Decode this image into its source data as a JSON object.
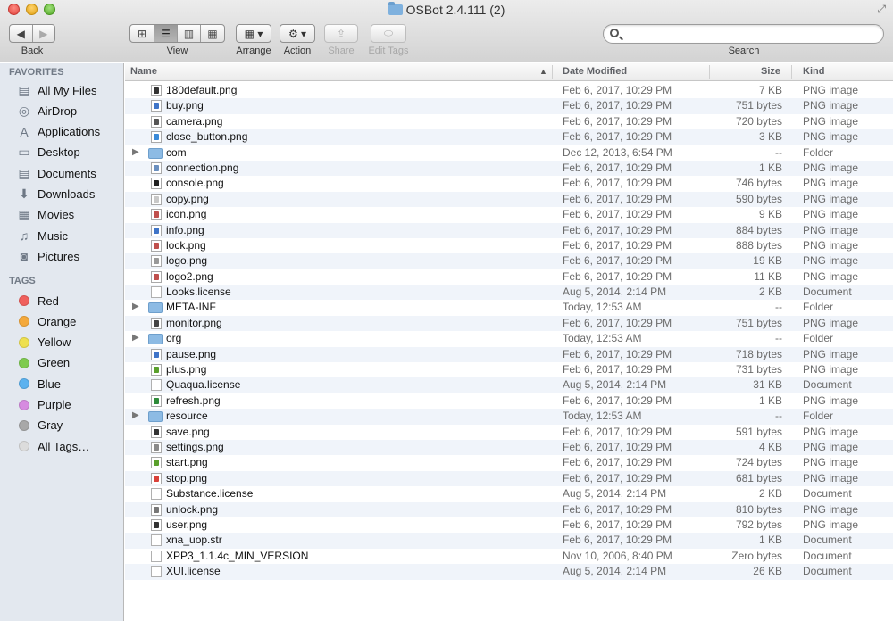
{
  "window": {
    "title": "OSBot 2.4.111 (2)",
    "fullscreen_glyph": "⤢"
  },
  "toolbar": {
    "back_label": "Back",
    "view_label": "View",
    "arrange_label": "Arrange",
    "action_label": "Action",
    "share_label": "Share",
    "edit_tags_label": "Edit Tags",
    "search_label": "Search",
    "search_placeholder": "",
    "back_glyph": "◀",
    "forward_glyph": "▶",
    "view_icons_glyph": "⊞",
    "view_list_glyph": "☰",
    "view_columns_glyph": "▥",
    "view_coverflow_glyph": "▦",
    "arrange_glyph": "▦ ▾",
    "action_glyph": "⚙ ▾",
    "share_glyph": "⇪",
    "edit_tags_glyph": "⬭"
  },
  "sidebar": {
    "favorites_heading": "FAVORITES",
    "favorites": [
      {
        "label": "All My Files",
        "icon": "all-files-icon",
        "glyph": "▤"
      },
      {
        "label": "AirDrop",
        "icon": "airdrop-icon",
        "glyph": "◎"
      },
      {
        "label": "Applications",
        "icon": "applications-icon",
        "glyph": "A"
      },
      {
        "label": "Desktop",
        "icon": "desktop-icon",
        "glyph": "▭"
      },
      {
        "label": "Documents",
        "icon": "documents-icon",
        "glyph": "▤"
      },
      {
        "label": "Downloads",
        "icon": "downloads-icon",
        "glyph": "⬇"
      },
      {
        "label": "Movies",
        "icon": "movies-icon",
        "glyph": "▦"
      },
      {
        "label": "Music",
        "icon": "music-icon",
        "glyph": "♫"
      },
      {
        "label": "Pictures",
        "icon": "pictures-icon",
        "glyph": "◙"
      }
    ],
    "tags_heading": "TAGS",
    "tags": [
      {
        "label": "Red",
        "color": "#f0605d"
      },
      {
        "label": "Orange",
        "color": "#f4a93c"
      },
      {
        "label": "Yellow",
        "color": "#eee04f"
      },
      {
        "label": "Green",
        "color": "#7ecb4f"
      },
      {
        "label": "Blue",
        "color": "#5cb2ef"
      },
      {
        "label": "Purple",
        "color": "#d68be0"
      },
      {
        "label": "Gray",
        "color": "#a8a8a8"
      },
      {
        "label": "All Tags…",
        "color": "#dcdcdc"
      }
    ]
  },
  "columns": {
    "name": "Name",
    "date": "Date Modified",
    "size": "Size",
    "kind": "Kind",
    "sort_glyph": "▲"
  },
  "files": [
    {
      "name": "180default.png",
      "date": "Feb 6, 2017, 10:29 PM",
      "size": "7 KB",
      "kind": "PNG image",
      "type": "png",
      "color": "#333333"
    },
    {
      "name": "buy.png",
      "date": "Feb 6, 2017, 10:29 PM",
      "size": "751 bytes",
      "kind": "PNG image",
      "type": "png",
      "color": "#3f74c8"
    },
    {
      "name": "camera.png",
      "date": "Feb 6, 2017, 10:29 PM",
      "size": "720 bytes",
      "kind": "PNG image",
      "type": "png",
      "color": "#555555"
    },
    {
      "name": "close_button.png",
      "date": "Feb 6, 2017, 10:29 PM",
      "size": "3 KB",
      "kind": "PNG image",
      "type": "png",
      "color": "#3a8ad8"
    },
    {
      "name": "com",
      "date": "Dec 12, 2013, 6:54 PM",
      "size": "--",
      "kind": "Folder",
      "type": "folder",
      "color": "#8dbbe4"
    },
    {
      "name": "connection.png",
      "date": "Feb 6, 2017, 10:29 PM",
      "size": "1 KB",
      "kind": "PNG image",
      "type": "png",
      "color": "#6a8fbf"
    },
    {
      "name": "console.png",
      "date": "Feb 6, 2017, 10:29 PM",
      "size": "746 bytes",
      "kind": "PNG image",
      "type": "png",
      "color": "#222222"
    },
    {
      "name": "copy.png",
      "date": "Feb 6, 2017, 10:29 PM",
      "size": "590 bytes",
      "kind": "PNG image",
      "type": "png",
      "color": "#c8c8c8"
    },
    {
      "name": "icon.png",
      "date": "Feb 6, 2017, 10:29 PM",
      "size": "9 KB",
      "kind": "PNG image",
      "type": "png",
      "color": "#c0504d"
    },
    {
      "name": "info.png",
      "date": "Feb 6, 2017, 10:29 PM",
      "size": "884 bytes",
      "kind": "PNG image",
      "type": "png",
      "color": "#3f74c8"
    },
    {
      "name": "lock.png",
      "date": "Feb 6, 2017, 10:29 PM",
      "size": "888 bytes",
      "kind": "PNG image",
      "type": "png",
      "color": "#c0504d"
    },
    {
      "name": "logo.png",
      "date": "Feb 6, 2017, 10:29 PM",
      "size": "19 KB",
      "kind": "PNG image",
      "type": "png",
      "color": "#999999"
    },
    {
      "name": "logo2.png",
      "date": "Feb 6, 2017, 10:29 PM",
      "size": "11 KB",
      "kind": "PNG image",
      "type": "png",
      "color": "#c0504d"
    },
    {
      "name": "Looks.license",
      "date": "Aug 5, 2014, 2:14 PM",
      "size": "2 KB",
      "kind": "Document",
      "type": "doc",
      "color": "#ffffff"
    },
    {
      "name": "META-INF",
      "date": "Today, 12:53 AM",
      "size": "--",
      "kind": "Folder",
      "type": "folder",
      "color": "#8dbbe4"
    },
    {
      "name": "monitor.png",
      "date": "Feb 6, 2017, 10:29 PM",
      "size": "751 bytes",
      "kind": "PNG image",
      "type": "png",
      "color": "#444444"
    },
    {
      "name": "org",
      "date": "Today, 12:53 AM",
      "size": "--",
      "kind": "Folder",
      "type": "folder",
      "color": "#8dbbe4"
    },
    {
      "name": "pause.png",
      "date": "Feb 6, 2017, 10:29 PM",
      "size": "718 bytes",
      "kind": "PNG image",
      "type": "png",
      "color": "#3f74c8"
    },
    {
      "name": "plus.png",
      "date": "Feb 6, 2017, 10:29 PM",
      "size": "731 bytes",
      "kind": "PNG image",
      "type": "png",
      "color": "#5aa02c"
    },
    {
      "name": "Quaqua.license",
      "date": "Aug 5, 2014, 2:14 PM",
      "size": "31 KB",
      "kind": "Document",
      "type": "doc",
      "color": "#ffffff"
    },
    {
      "name": "refresh.png",
      "date": "Feb 6, 2017, 10:29 PM",
      "size": "1 KB",
      "kind": "PNG image",
      "type": "png",
      "color": "#2e8b3a"
    },
    {
      "name": "resource",
      "date": "Today, 12:53 AM",
      "size": "--",
      "kind": "Folder",
      "type": "folder",
      "color": "#8dbbe4"
    },
    {
      "name": "save.png",
      "date": "Feb 6, 2017, 10:29 PM",
      "size": "591 bytes",
      "kind": "PNG image",
      "type": "png",
      "color": "#333333"
    },
    {
      "name": "settings.png",
      "date": "Feb 6, 2017, 10:29 PM",
      "size": "4 KB",
      "kind": "PNG image",
      "type": "png",
      "color": "#8a8a8a"
    },
    {
      "name": "start.png",
      "date": "Feb 6, 2017, 10:29 PM",
      "size": "724 bytes",
      "kind": "PNG image",
      "type": "png",
      "color": "#5aa02c"
    },
    {
      "name": "stop.png",
      "date": "Feb 6, 2017, 10:29 PM",
      "size": "681 bytes",
      "kind": "PNG image",
      "type": "png",
      "color": "#d9413a"
    },
    {
      "name": "Substance.license",
      "date": "Aug 5, 2014, 2:14 PM",
      "size": "2 KB",
      "kind": "Document",
      "type": "doc",
      "color": "#ffffff"
    },
    {
      "name": "unlock.png",
      "date": "Feb 6, 2017, 10:29 PM",
      "size": "810 bytes",
      "kind": "PNG image",
      "type": "png",
      "color": "#777777"
    },
    {
      "name": "user.png",
      "date": "Feb 6, 2017, 10:29 PM",
      "size": "792 bytes",
      "kind": "PNG image",
      "type": "png",
      "color": "#333333"
    },
    {
      "name": "xna_uop.str",
      "date": "Feb 6, 2017, 10:29 PM",
      "size": "1 KB",
      "kind": "Document",
      "type": "doc",
      "color": "#ffffff"
    },
    {
      "name": "XPP3_1.1.4c_MIN_VERSION",
      "date": "Nov 10, 2006, 8:40 PM",
      "size": "Zero bytes",
      "kind": "Document",
      "type": "doc",
      "color": "#ffffff"
    },
    {
      "name": "XUI.license",
      "date": "Aug 5, 2014, 2:14 PM",
      "size": "26 KB",
      "kind": "Document",
      "type": "doc",
      "color": "#ffffff"
    }
  ],
  "folder_disclosure_glyph": "▶"
}
